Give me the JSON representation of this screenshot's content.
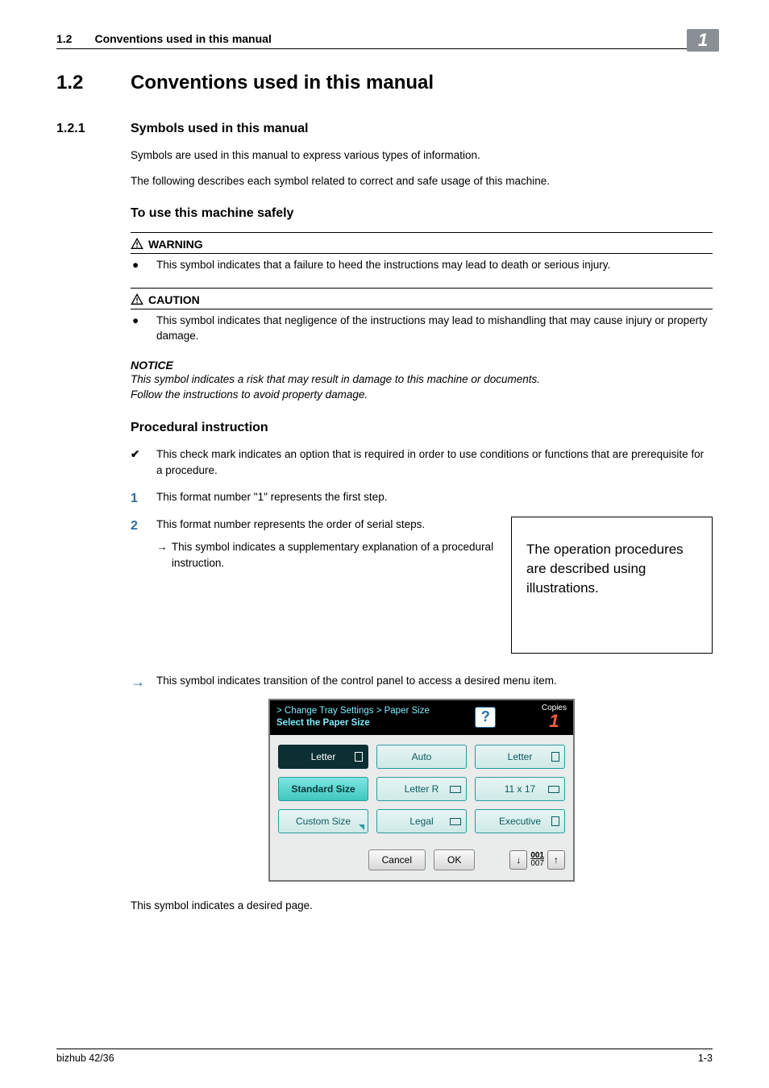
{
  "header": {
    "section_number": "1.2",
    "section_title": "Conventions used in this manual",
    "chapter_badge": "1"
  },
  "h1": {
    "num": "1.2",
    "title": "Conventions used in this manual"
  },
  "h2": {
    "num": "1.2.1",
    "title": "Symbols used in this manual"
  },
  "intro": {
    "p1": "Symbols are used in this manual to express various types of information.",
    "p2": "The following describes each symbol related to correct and safe usage of this machine."
  },
  "safely_heading": "To use this machine safely",
  "warning": {
    "label": "WARNING",
    "text": "This symbol indicates that a failure to heed the instructions may lead to death or serious injury."
  },
  "caution": {
    "label": "CAUTION",
    "text": "This symbol indicates that negligence of the instructions may lead to mishandling that may cause injury or property damage."
  },
  "notice": {
    "label": "NOTICE",
    "line1": "This symbol indicates a risk that may result in damage to this machine or documents.",
    "line2": "Follow the instructions to avoid property damage."
  },
  "procedural_heading": "Procedural instruction",
  "checkmark_text": "This check mark indicates an option that is required in order to use conditions or functions that are prerequisite for a procedure.",
  "step1": {
    "num": "1",
    "text": "This format number \"1\" represents the first step."
  },
  "step2": {
    "num": "2",
    "text": "This format number represents the order of serial steps.",
    "sub": "This symbol indicates a supplementary explanation of a procedural instruction."
  },
  "illustration_note": "The operation procedures are described using illustrations.",
  "transition_text": "This symbol indicates transition of the control panel to access a desired menu item.",
  "panel": {
    "breadcrumb_line1": "> Change Tray Settings > Paper Size",
    "breadcrumb_line2": "Select the Paper Size",
    "copies_label": "Copies",
    "copies_value": "1",
    "help": "?",
    "buttons": {
      "r1c1": "Letter",
      "r1c2": "Auto",
      "r1c3": "Letter",
      "r2c1": "Standard Size",
      "r2c2": "Letter R",
      "r2c3": "11 x 17",
      "r3c1": "Custom Size",
      "r3c2": "Legal",
      "r3c3": "Executive"
    },
    "cancel": "Cancel",
    "ok": "OK",
    "page_current": "001",
    "page_total": "007"
  },
  "desired_page_text": "This symbol indicates a desired page.",
  "footer": {
    "product": "bizhub 42/36",
    "page": "1-3"
  }
}
